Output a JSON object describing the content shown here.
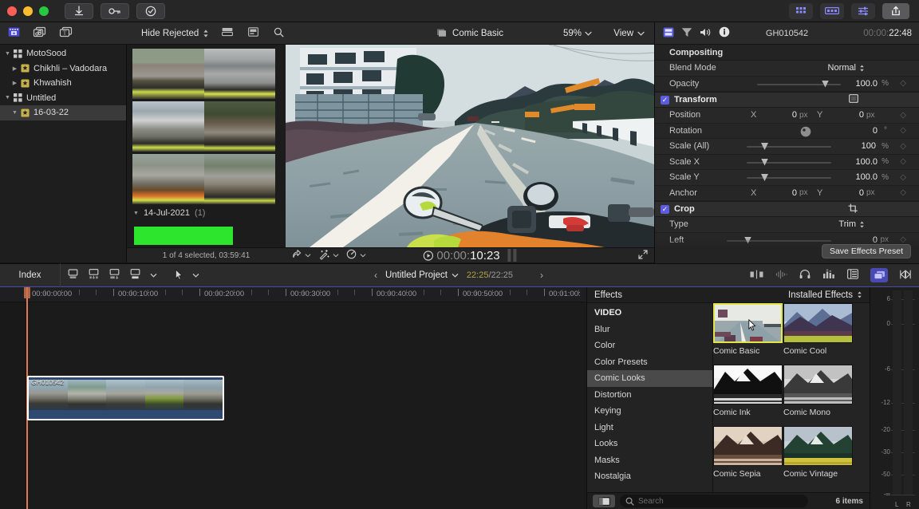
{
  "titlebar": {
    "buttons": [
      {
        "name": "import-media",
        "icon": "download-icon"
      },
      {
        "name": "keyword-editor",
        "icon": "key-icon"
      },
      {
        "name": "background-tasks",
        "icon": "check-circle-icon"
      }
    ],
    "right_buttons": [
      {
        "name": "browser-toggle",
        "icon": "grid-icon"
      },
      {
        "name": "timeline-toggle",
        "icon": "timeline-icon"
      },
      {
        "name": "inspector-toggle",
        "icon": "sliders-icon"
      },
      {
        "name": "share-button",
        "icon": "share-icon"
      }
    ]
  },
  "browser_toolbar": {
    "filter_label": "Hide Rejected",
    "icons": [
      "libraries-icon",
      "photos-audio-icon",
      "titles-generators-icon"
    ],
    "right_icons": [
      "filmstrip-view-icon",
      "list-view-icon",
      "search-icon"
    ]
  },
  "viewer_header": {
    "clip_icon": "effect-icon",
    "title": "Comic Basic",
    "zoom": "59%",
    "view_label": "View"
  },
  "sidebar": {
    "items": [
      {
        "label": "MotoSood",
        "icon": "library-icon",
        "triangle": "down",
        "indent": 0,
        "selected": false
      },
      {
        "label": "Chikhli – Vadodara",
        "icon": "event-icon",
        "triangle": "right",
        "indent": 1,
        "selected": false
      },
      {
        "label": "Khwahish",
        "icon": "event-icon",
        "triangle": "right",
        "indent": 1,
        "selected": false
      },
      {
        "label": "Untitled",
        "icon": "library-icon",
        "triangle": "down",
        "indent": 0,
        "selected": false
      },
      {
        "label": "16-03-22",
        "icon": "event-icon",
        "triangle": "down",
        "indent": 1,
        "selected": true
      }
    ]
  },
  "browser": {
    "date_group": "14-Jul-2021",
    "date_count": "(1)",
    "status": "1 of 4 selected, 03:59:41"
  },
  "viewer_bar": {
    "tools": [
      "share-icon",
      "enhance-icon",
      "retime-icon"
    ],
    "timecode_prefix": "00:00:",
    "timecode_main": "10:23",
    "play_icon": "play-icon",
    "expand_icon": "expand-icon"
  },
  "inspector": {
    "tabs": [
      "video-inspector-icon",
      "info-inspector-icon",
      "audio-inspector-icon",
      "generator-inspector-icon"
    ],
    "clip_name": "GH010542",
    "timecode_dim": "00:00:",
    "timecode_main": "22:48",
    "sections": [
      {
        "title": "Compositing"
      }
    ],
    "rows": [
      {
        "label": "Blend Mode",
        "type": "popup",
        "value": "Normal"
      },
      {
        "label": "Opacity",
        "type": "slider",
        "value": "100.0",
        "unit": "%"
      }
    ],
    "transform": {
      "group": "Transform",
      "checked": true,
      "icon": "transform-onscreen-icon",
      "rows": [
        {
          "label": "Position",
          "type": "xy",
          "x_label": "X",
          "x_value": "0",
          "x_unit": "px",
          "y_label": "Y",
          "y_value": "0",
          "y_unit": "px"
        },
        {
          "label": "Rotation",
          "type": "dial",
          "value": "0",
          "unit": "°"
        },
        {
          "label": "Scale (All)",
          "type": "slider",
          "value": "100",
          "unit": "%"
        },
        {
          "label": "Scale X",
          "type": "slider",
          "value": "100.0",
          "unit": "%"
        },
        {
          "label": "Scale Y",
          "type": "slider",
          "value": "100.0",
          "unit": "%"
        },
        {
          "label": "Anchor",
          "type": "xy",
          "x_label": "X",
          "x_value": "0",
          "x_unit": "px",
          "y_label": "Y",
          "y_value": "0",
          "y_unit": "px"
        }
      ]
    },
    "crop": {
      "group": "Crop",
      "checked": true,
      "icon": "crop-onscreen-icon",
      "rows": [
        {
          "label": "Type",
          "type": "popup",
          "value": "Trim"
        },
        {
          "label": "Left",
          "type": "slider",
          "value": "0",
          "unit": "px"
        }
      ]
    },
    "save_preset_label": "Save Effects Preset"
  },
  "timeline_toolbar": {
    "index_label": "Index",
    "left_icons": [
      "append-icon",
      "insert-icon",
      "connect-icon",
      "overwrite-icon",
      "tool-select-icon"
    ],
    "prev_arrow": "‹",
    "project_name": "Untitled Project",
    "duration_current": "22:25",
    "duration_total": "22:25",
    "duration_sep": "/",
    "next_arrow": "›",
    "right_icons": [
      "solo-icon",
      "audio-waveform-icon",
      "headphone-icon",
      "audio-meters-icon",
      "timeline-index-icon",
      "clip-appearance-icon",
      "fit-timeline-icon"
    ]
  },
  "timeline": {
    "ruler_labels": [
      "00:00:00:00",
      "00:00:10:00",
      "00:00:20:00",
      "00:00:30:00",
      "00:00:40:00",
      "00:00:50:00",
      "00:01:00:"
    ],
    "clip": {
      "name": "GH010542"
    }
  },
  "effects": {
    "title": "Effects",
    "installed_label": "Installed Effects",
    "categories": [
      {
        "label": "VIDEO",
        "is_header": true,
        "selected": false
      },
      {
        "label": "Blur",
        "is_header": false,
        "selected": false
      },
      {
        "label": "Color",
        "is_header": false,
        "selected": false
      },
      {
        "label": "Color Presets",
        "is_header": false,
        "selected": false
      },
      {
        "label": "Comic Looks",
        "is_header": false,
        "selected": true
      },
      {
        "label": "Distortion",
        "is_header": false,
        "selected": false
      },
      {
        "label": "Keying",
        "is_header": false,
        "selected": false
      },
      {
        "label": "Light",
        "is_header": false,
        "selected": false
      },
      {
        "label": "Looks",
        "is_header": false,
        "selected": false
      },
      {
        "label": "Masks",
        "is_header": false,
        "selected": false
      },
      {
        "label": "Nostalgia",
        "is_header": false,
        "selected": false
      }
    ],
    "items": [
      {
        "label": "Comic Basic",
        "active": true,
        "style": "basic"
      },
      {
        "label": "Comic Cool",
        "active": false,
        "style": "cool"
      },
      {
        "label": "Comic Ink",
        "active": false,
        "style": "ink"
      },
      {
        "label": "Comic Mono",
        "active": false,
        "style": "mono"
      },
      {
        "label": "Comic Sepia",
        "active": false,
        "style": "sepia"
      },
      {
        "label": "Comic Vintage",
        "active": false,
        "style": "vintage"
      }
    ],
    "search_placeholder": "Search",
    "item_count": "6 items",
    "sidebar_toggle_icon": "sidebar-icon",
    "search_icon": "search-icon"
  },
  "audio_meter": {
    "scale": [
      "6",
      "0",
      "-6",
      "-12",
      "-20",
      "-30",
      "-50",
      "-∞"
    ],
    "channels": [
      "L",
      "R"
    ]
  },
  "colors": {
    "accent": "#5c5ce0",
    "selection": "#e3e34a",
    "window_bg": "#1a1a1a",
    "panel_bg": "#242424",
    "clip_blue": "#2e4a73",
    "green_marker": "#2ce52c"
  }
}
